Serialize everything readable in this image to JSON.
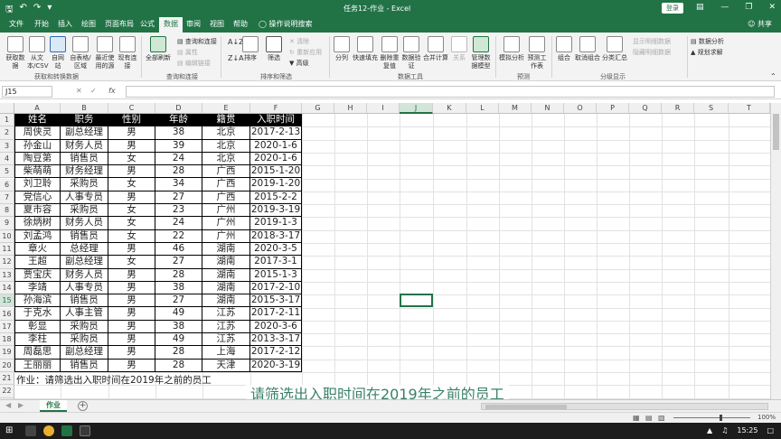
{
  "titlebar": {
    "title": "任务12-作业 - Excel",
    "login_label": "登录",
    "save_icon": "save-icon",
    "undo_icon": "undo-icon",
    "redo_icon": "redo-icon"
  },
  "ribbon_tabs": [
    "文件",
    "开始",
    "插入",
    "绘图",
    "页面布局",
    "公式",
    "数据",
    "审阅",
    "视图",
    "帮助"
  ],
  "active_tab": "数据",
  "tell_me": "操作说明搜索",
  "share_label": "共享",
  "ribbon": {
    "get_data": "获取数据",
    "from_text": "从文本/CSV",
    "from_web": "自网站",
    "from_table": "自表格/区域",
    "recent_sources": "最近使用的源",
    "existing_conn": "现有连接",
    "group_get": "获取和转换数据",
    "refresh_all": "全部刷新",
    "queries_conn": "查询和连接",
    "properties": "属性",
    "edit_links": "编辑链接",
    "group_queries": "查询和连接",
    "sort_label": "排序",
    "filter_label": "筛选",
    "clear_label": "清除",
    "reapply_label": "重新应用",
    "advanced_label": "高级",
    "group_sort": "排序和筛选",
    "text_to_col": "分列",
    "flash_fill": "快速填充",
    "remove_dup": "删除重复值",
    "data_valid": "数据验证",
    "consolidate": "合并计算",
    "relationships": "关系",
    "manage_model": "管理数据模型",
    "group_tools": "数据工具",
    "what_if": "模拟分析",
    "forecast": "预测工作表",
    "group_forecast": "预测",
    "group_btn": "组合",
    "ungroup_btn": "取消组合",
    "subtotal": "分类汇总",
    "show_detail": "显示明细数据",
    "hide_detail": "隐藏明细数据",
    "group_outline": "分级显示",
    "data_analysis": "数据分析",
    "solver": "规划求解"
  },
  "name_box": "J15",
  "fx_label": "fx",
  "columns": [
    "A",
    "B",
    "C",
    "D",
    "E",
    "F",
    "G",
    "H",
    "I",
    "J",
    "K",
    "L",
    "M",
    "N",
    "O",
    "P",
    "Q",
    "R",
    "S",
    "T"
  ],
  "selected_column": "J",
  "row_numbers": [
    "1",
    "2",
    "3",
    "4",
    "5",
    "6",
    "7",
    "8",
    "9",
    "10",
    "11",
    "12",
    "13",
    "14",
    "15",
    "16",
    "17",
    "18",
    "19",
    "20",
    "21",
    "22",
    "23"
  ],
  "table_header": [
    "姓名",
    "职务",
    "性别",
    "年龄",
    "籍贯",
    "入职时间"
  ],
  "table_rows": [
    [
      "周侠灵",
      "副总经理",
      "男",
      "38",
      "北京",
      "2017-2-13"
    ],
    [
      "孙金山",
      "财务人员",
      "男",
      "39",
      "北京",
      "2020-1-6"
    ],
    [
      "陶豆第",
      "销售员",
      "女",
      "24",
      "北京",
      "2020-1-6"
    ],
    [
      "柴萌萌",
      "财务经理",
      "男",
      "28",
      "广西",
      "2015-1-20"
    ],
    [
      "刘卫聆",
      "采购员",
      "女",
      "34",
      "广西",
      "2019-1-20"
    ],
    [
      "党信心",
      "人事专员",
      "男",
      "27",
      "广西",
      "2015-2-2"
    ],
    [
      "夏市容",
      "采购员",
      "女",
      "23",
      "广州",
      "2019-3-19"
    ],
    [
      "徐炳树",
      "财务人员",
      "女",
      "24",
      "广州",
      "2019-1-3"
    ],
    [
      "刘孟鸿",
      "销售员",
      "女",
      "22",
      "广州",
      "2018-3-17"
    ],
    [
      "章火",
      "总经理",
      "男",
      "46",
      "湖南",
      "2020-3-5"
    ],
    [
      "王超",
      "副总经理",
      "女",
      "27",
      "湖南",
      "2017-3-1"
    ],
    [
      "贾宝庆",
      "财务人员",
      "男",
      "28",
      "湖南",
      "2015-1-3"
    ],
    [
      "李靖",
      "人事专员",
      "男",
      "38",
      "湖南",
      "2017-2-10"
    ],
    [
      "孙海滨",
      "销售员",
      "男",
      "27",
      "湖南",
      "2015-3-17"
    ],
    [
      "于克水",
      "人事主管",
      "男",
      "49",
      "江苏",
      "2017-2-11"
    ],
    [
      "彰显",
      "采购员",
      "男",
      "38",
      "江苏",
      "2020-3-6"
    ],
    [
      "李柱",
      "采购员",
      "男",
      "49",
      "江苏",
      "2013-3-17"
    ],
    [
      "周磊思",
      "副总经理",
      "男",
      "28",
      "上海",
      "2017-2-12"
    ],
    [
      "王丽丽",
      "销售员",
      "男",
      "28",
      "天津",
      "2020-3-19"
    ]
  ],
  "note": "作业：请筛选出入职时间在2019年之前的员工",
  "subtitle": "请筛选出入职时间在2019年之前的员工",
  "sheet_tab": "作业",
  "zoom_label": "100%",
  "clock": "15:25",
  "accent_color": "#217346"
}
